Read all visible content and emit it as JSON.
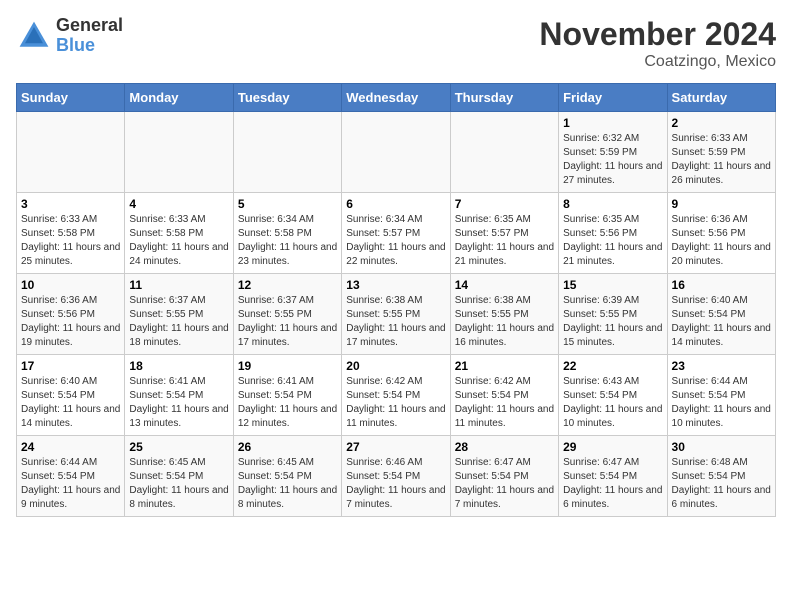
{
  "logo": {
    "general": "General",
    "blue": "Blue"
  },
  "title": "November 2024",
  "subtitle": "Coatzingo, Mexico",
  "days_of_week": [
    "Sunday",
    "Monday",
    "Tuesday",
    "Wednesday",
    "Thursday",
    "Friday",
    "Saturday"
  ],
  "weeks": [
    [
      {
        "day": "",
        "empty": true
      },
      {
        "day": "",
        "empty": true
      },
      {
        "day": "",
        "empty": true
      },
      {
        "day": "",
        "empty": true
      },
      {
        "day": "",
        "empty": true
      },
      {
        "day": "1",
        "sunrise": "Sunrise: 6:32 AM",
        "sunset": "Sunset: 5:59 PM",
        "daylight": "Daylight: 11 hours and 27 minutes."
      },
      {
        "day": "2",
        "sunrise": "Sunrise: 6:33 AM",
        "sunset": "Sunset: 5:59 PM",
        "daylight": "Daylight: 11 hours and 26 minutes."
      }
    ],
    [
      {
        "day": "3",
        "sunrise": "Sunrise: 6:33 AM",
        "sunset": "Sunset: 5:58 PM",
        "daylight": "Daylight: 11 hours and 25 minutes."
      },
      {
        "day": "4",
        "sunrise": "Sunrise: 6:33 AM",
        "sunset": "Sunset: 5:58 PM",
        "daylight": "Daylight: 11 hours and 24 minutes."
      },
      {
        "day": "5",
        "sunrise": "Sunrise: 6:34 AM",
        "sunset": "Sunset: 5:58 PM",
        "daylight": "Daylight: 11 hours and 23 minutes."
      },
      {
        "day": "6",
        "sunrise": "Sunrise: 6:34 AM",
        "sunset": "Sunset: 5:57 PM",
        "daylight": "Daylight: 11 hours and 22 minutes."
      },
      {
        "day": "7",
        "sunrise": "Sunrise: 6:35 AM",
        "sunset": "Sunset: 5:57 PM",
        "daylight": "Daylight: 11 hours and 21 minutes."
      },
      {
        "day": "8",
        "sunrise": "Sunrise: 6:35 AM",
        "sunset": "Sunset: 5:56 PM",
        "daylight": "Daylight: 11 hours and 21 minutes."
      },
      {
        "day": "9",
        "sunrise": "Sunrise: 6:36 AM",
        "sunset": "Sunset: 5:56 PM",
        "daylight": "Daylight: 11 hours and 20 minutes."
      }
    ],
    [
      {
        "day": "10",
        "sunrise": "Sunrise: 6:36 AM",
        "sunset": "Sunset: 5:56 PM",
        "daylight": "Daylight: 11 hours and 19 minutes."
      },
      {
        "day": "11",
        "sunrise": "Sunrise: 6:37 AM",
        "sunset": "Sunset: 5:55 PM",
        "daylight": "Daylight: 11 hours and 18 minutes."
      },
      {
        "day": "12",
        "sunrise": "Sunrise: 6:37 AM",
        "sunset": "Sunset: 5:55 PM",
        "daylight": "Daylight: 11 hours and 17 minutes."
      },
      {
        "day": "13",
        "sunrise": "Sunrise: 6:38 AM",
        "sunset": "Sunset: 5:55 PM",
        "daylight": "Daylight: 11 hours and 17 minutes."
      },
      {
        "day": "14",
        "sunrise": "Sunrise: 6:38 AM",
        "sunset": "Sunset: 5:55 PM",
        "daylight": "Daylight: 11 hours and 16 minutes."
      },
      {
        "day": "15",
        "sunrise": "Sunrise: 6:39 AM",
        "sunset": "Sunset: 5:55 PM",
        "daylight": "Daylight: 11 hours and 15 minutes."
      },
      {
        "day": "16",
        "sunrise": "Sunrise: 6:40 AM",
        "sunset": "Sunset: 5:54 PM",
        "daylight": "Daylight: 11 hours and 14 minutes."
      }
    ],
    [
      {
        "day": "17",
        "sunrise": "Sunrise: 6:40 AM",
        "sunset": "Sunset: 5:54 PM",
        "daylight": "Daylight: 11 hours and 14 minutes."
      },
      {
        "day": "18",
        "sunrise": "Sunrise: 6:41 AM",
        "sunset": "Sunset: 5:54 PM",
        "daylight": "Daylight: 11 hours and 13 minutes."
      },
      {
        "day": "19",
        "sunrise": "Sunrise: 6:41 AM",
        "sunset": "Sunset: 5:54 PM",
        "daylight": "Daylight: 11 hours and 12 minutes."
      },
      {
        "day": "20",
        "sunrise": "Sunrise: 6:42 AM",
        "sunset": "Sunset: 5:54 PM",
        "daylight": "Daylight: 11 hours and 11 minutes."
      },
      {
        "day": "21",
        "sunrise": "Sunrise: 6:42 AM",
        "sunset": "Sunset: 5:54 PM",
        "daylight": "Daylight: 11 hours and 11 minutes."
      },
      {
        "day": "22",
        "sunrise": "Sunrise: 6:43 AM",
        "sunset": "Sunset: 5:54 PM",
        "daylight": "Daylight: 11 hours and 10 minutes."
      },
      {
        "day": "23",
        "sunrise": "Sunrise: 6:44 AM",
        "sunset": "Sunset: 5:54 PM",
        "daylight": "Daylight: 11 hours and 10 minutes."
      }
    ],
    [
      {
        "day": "24",
        "sunrise": "Sunrise: 6:44 AM",
        "sunset": "Sunset: 5:54 PM",
        "daylight": "Daylight: 11 hours and 9 minutes."
      },
      {
        "day": "25",
        "sunrise": "Sunrise: 6:45 AM",
        "sunset": "Sunset: 5:54 PM",
        "daylight": "Daylight: 11 hours and 8 minutes."
      },
      {
        "day": "26",
        "sunrise": "Sunrise: 6:45 AM",
        "sunset": "Sunset: 5:54 PM",
        "daylight": "Daylight: 11 hours and 8 minutes."
      },
      {
        "day": "27",
        "sunrise": "Sunrise: 6:46 AM",
        "sunset": "Sunset: 5:54 PM",
        "daylight": "Daylight: 11 hours and 7 minutes."
      },
      {
        "day": "28",
        "sunrise": "Sunrise: 6:47 AM",
        "sunset": "Sunset: 5:54 PM",
        "daylight": "Daylight: 11 hours and 7 minutes."
      },
      {
        "day": "29",
        "sunrise": "Sunrise: 6:47 AM",
        "sunset": "Sunset: 5:54 PM",
        "daylight": "Daylight: 11 hours and 6 minutes."
      },
      {
        "day": "30",
        "sunrise": "Sunrise: 6:48 AM",
        "sunset": "Sunset: 5:54 PM",
        "daylight": "Daylight: 11 hours and 6 minutes."
      }
    ]
  ]
}
